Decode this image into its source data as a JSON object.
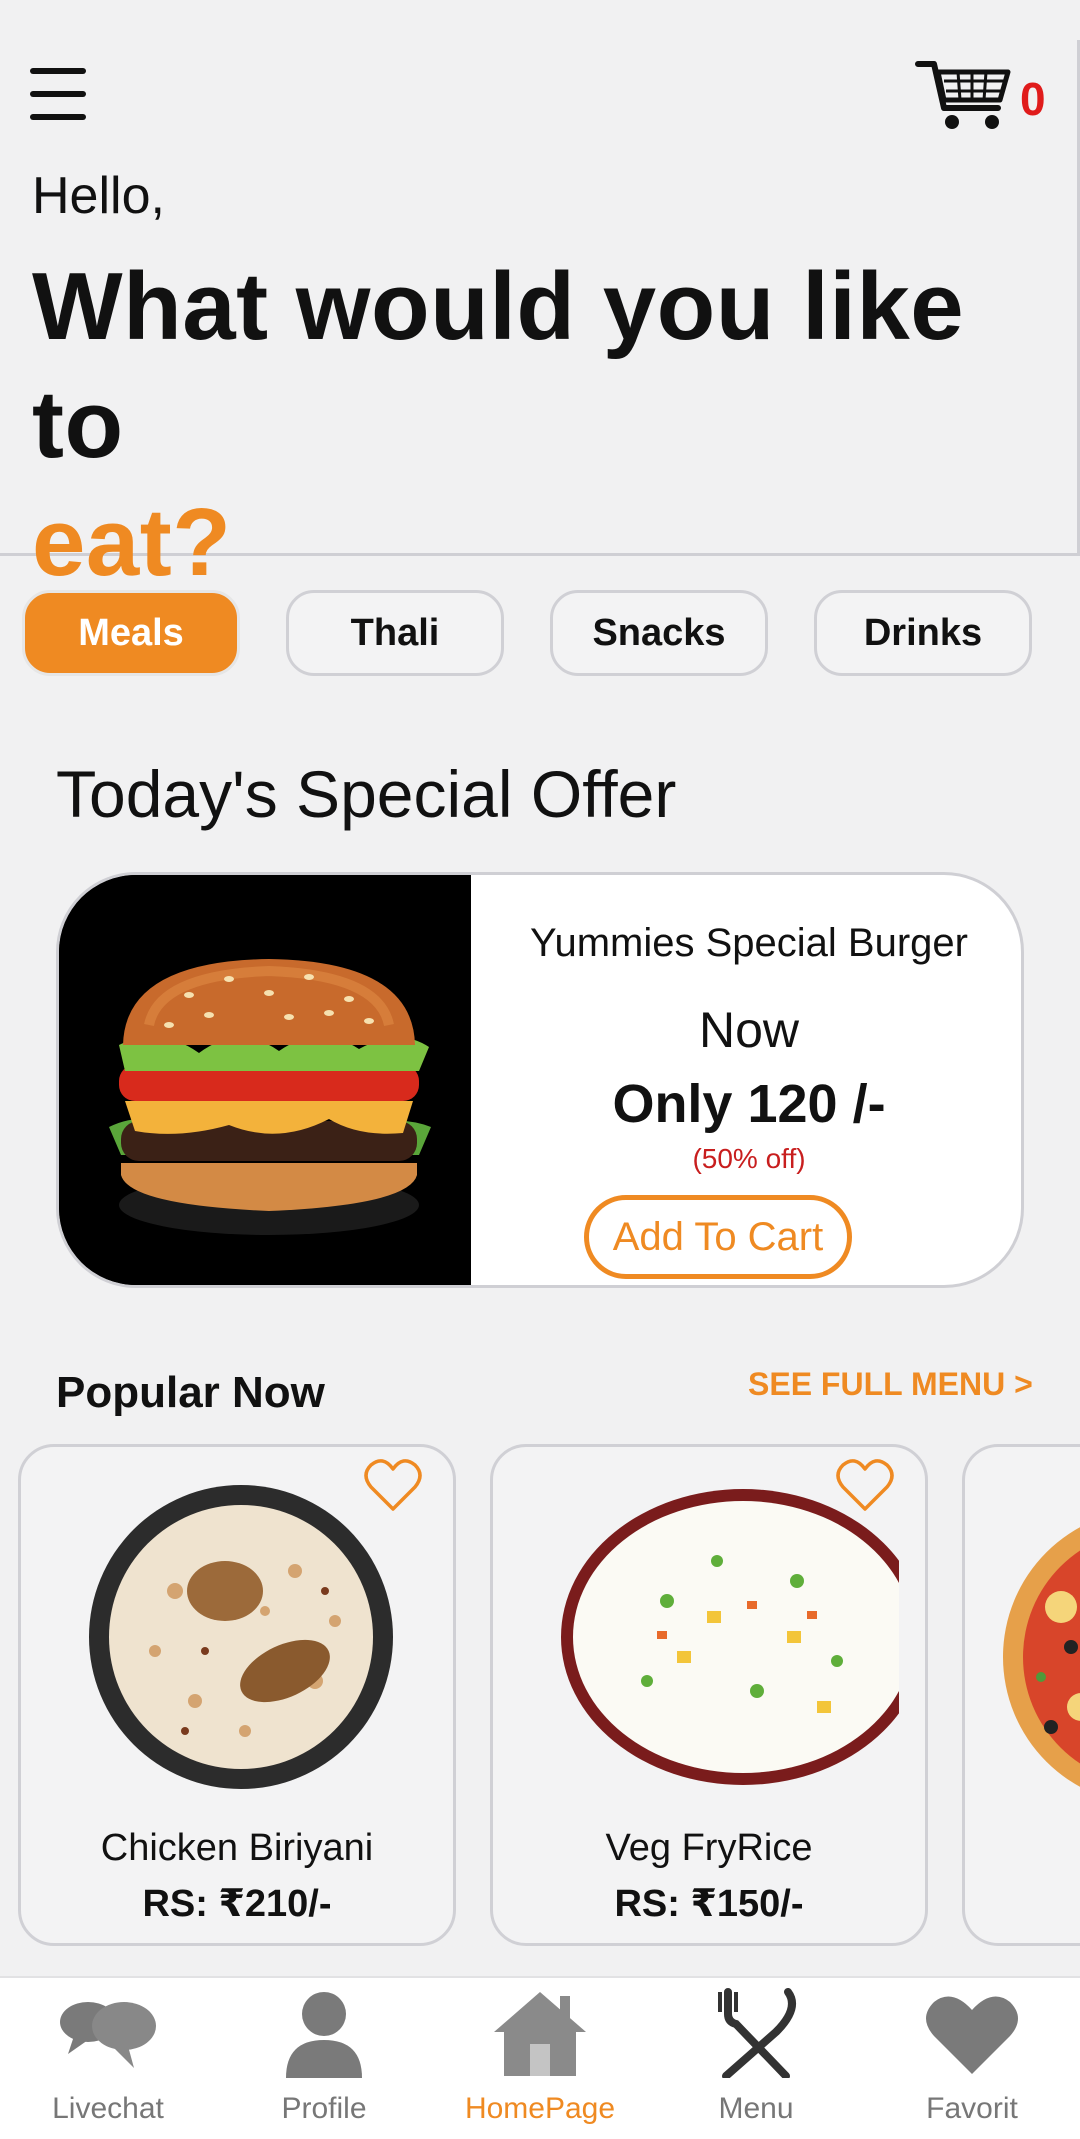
{
  "header": {
    "cart_count": "0",
    "greeting": "Hello,",
    "question_main": "What would you like to",
    "question_accent": "eat?"
  },
  "categories": [
    {
      "label": "Meals",
      "active": true
    },
    {
      "label": "Thali",
      "active": false
    },
    {
      "label": "Snacks",
      "active": false
    },
    {
      "label": "Drinks",
      "active": false
    }
  ],
  "special_offer": {
    "section_title": "Today's Special Offer",
    "name": "Yummies Special Burger",
    "now_label": "Now",
    "price": "Only 120 /-",
    "discount": "(50% off)",
    "add_button": "Add To Cart"
  },
  "popular": {
    "title": "Popular Now",
    "see_full_menu": "SEE FULL MENU >",
    "items": [
      {
        "name": "Chicken Biriyani",
        "price": "RS: ₹210/-"
      },
      {
        "name": "Veg FryRice",
        "price": "RS: ₹150/-"
      }
    ]
  },
  "bottom_nav": [
    {
      "label": "Livechat",
      "icon": "chat-icon"
    },
    {
      "label": "Profile",
      "icon": "person-icon"
    },
    {
      "label": "HomePage",
      "icon": "home-icon",
      "active": true
    },
    {
      "label": "Menu",
      "icon": "fork-knife-icon"
    },
    {
      "label": "Favorit",
      "icon": "heart-icon"
    }
  ],
  "colors": {
    "accent": "#ef8a22",
    "cart_count": "#e01b1b",
    "discount": "#c81e1e"
  }
}
